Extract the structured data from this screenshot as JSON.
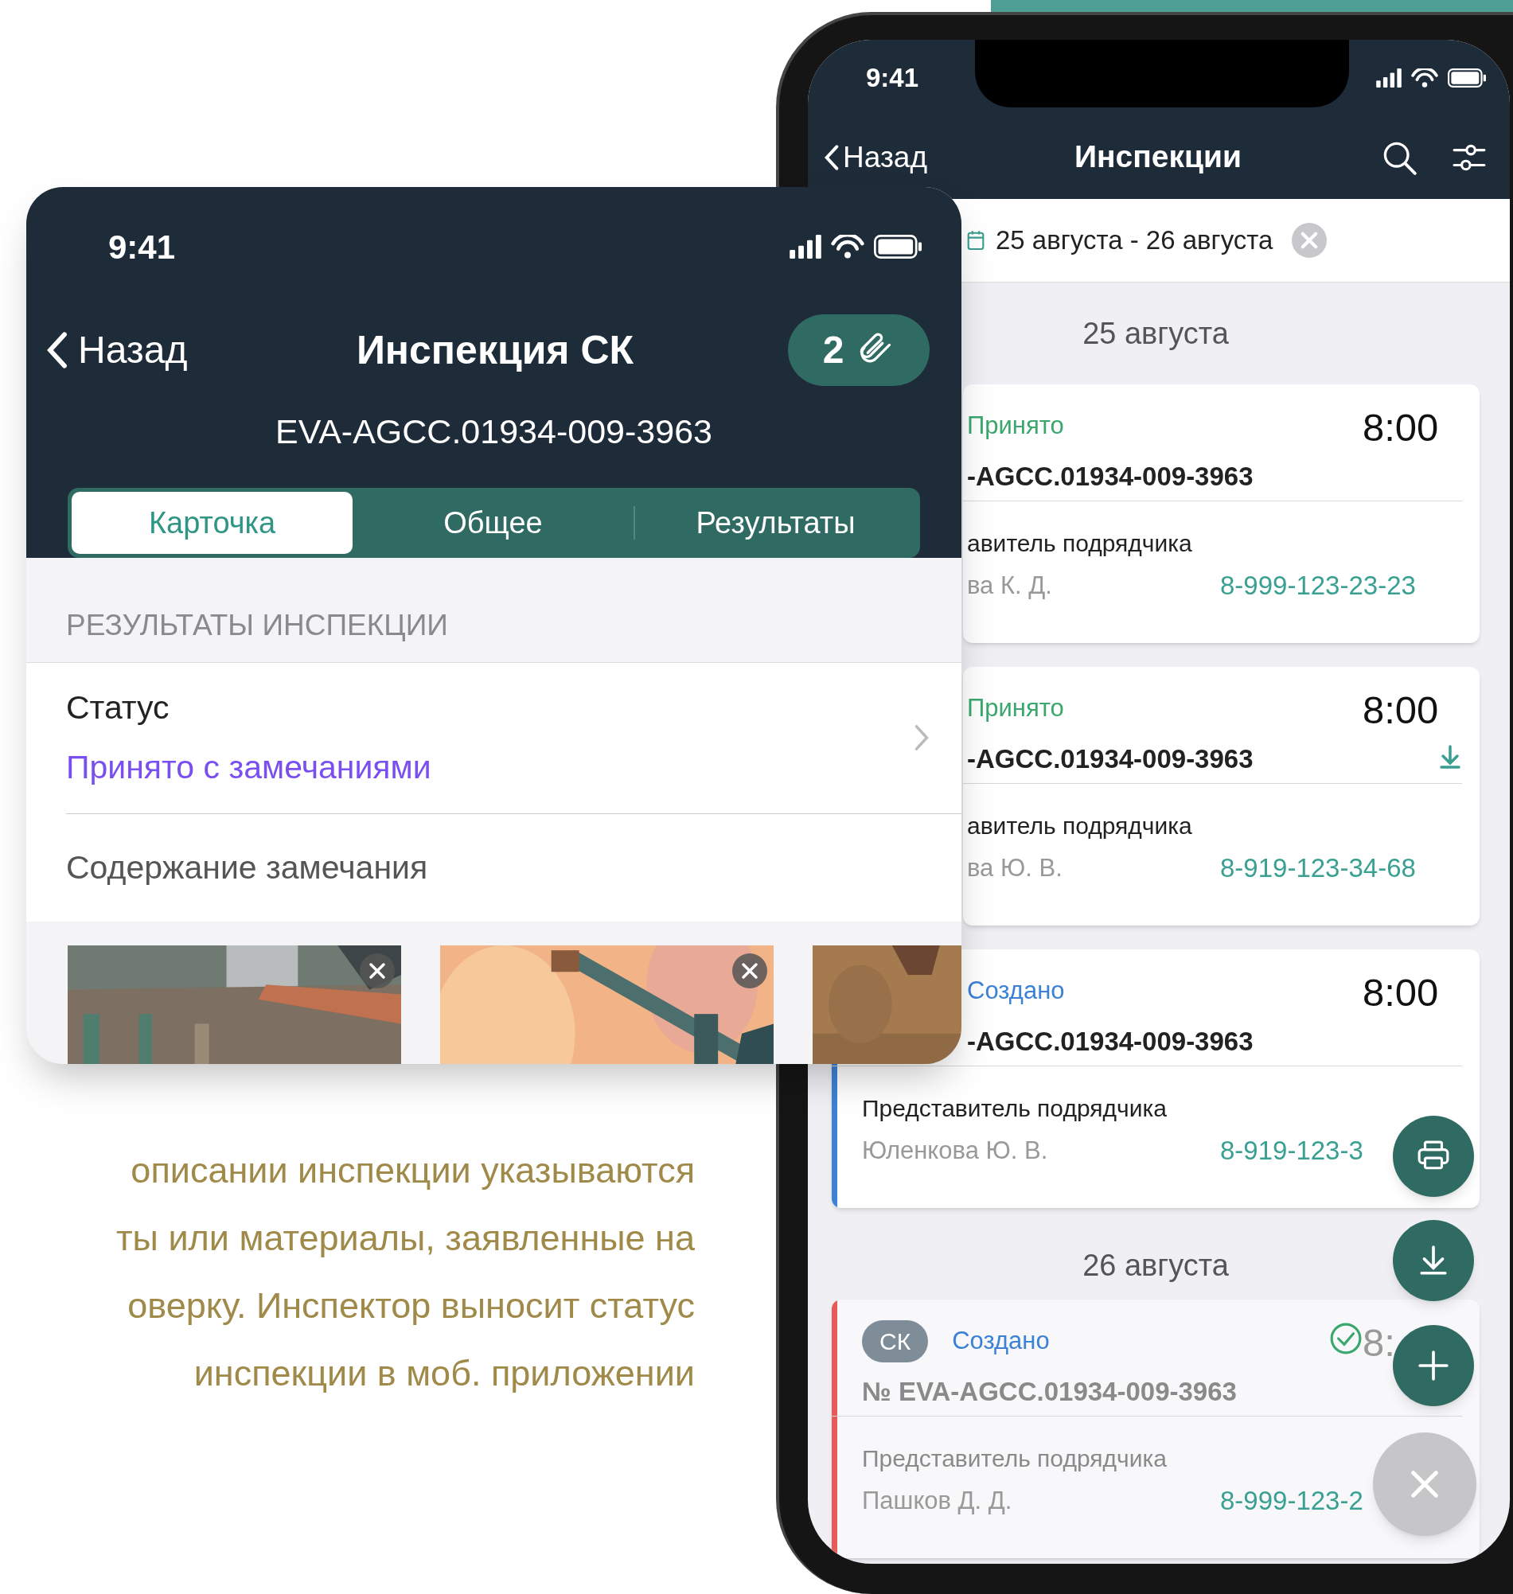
{
  "inspection_card": {
    "status_bar": {
      "time": "9:41"
    },
    "nav": {
      "back": "Назад",
      "title": "Инспекция СК",
      "attachments_count": "2"
    },
    "subtitle": "EVA-AGCC.01934-009-3963",
    "tabs": [
      {
        "label": "Карточка",
        "selected": true
      },
      {
        "label": "Общее",
        "selected": false
      },
      {
        "label": "Результаты",
        "selected": false
      }
    ],
    "section_header": "РЕЗУЛЬТАТЫ ИНСПЕКЦИИ",
    "status_row": {
      "label": "Статус",
      "value": "Принято с замечаниями"
    },
    "remark_row": {
      "label": "Содержание замечания"
    },
    "photos": [
      {
        "kind": "picture",
        "removable": true
      },
      {
        "kind": "picture",
        "removable": true
      },
      {
        "kind": "picture"
      }
    ]
  },
  "description": {
    "lines": [
      "описании инспекции указываются",
      "ты или материалы, заявленные на",
      "оверку. Инспектор выносит статус",
      "инспекции в моб. приложении"
    ]
  },
  "inspections_screen": {
    "status_bar": {
      "time": "9:41"
    },
    "nav": {
      "back": "Назад",
      "title": "Инспекции"
    },
    "date_filter": {
      "value": "25 августа - 26 августа"
    },
    "groups": [
      {
        "date": "25 августа",
        "cards": [
          {
            "kind": "accepted",
            "status": "Принято",
            "time": "8:00",
            "number": "-AGCC.01934-009-3963",
            "download": false,
            "checked": false,
            "label": "авитель подрядчика",
            "name": "ва К. Д.",
            "phone": "8-999-123-23-23",
            "faded": false
          },
          {
            "kind": "accepted",
            "status": "Принято",
            "time": "8:00",
            "number": "-AGCC.01934-009-3963",
            "download": true,
            "checked": false,
            "label": "авитель подрядчика",
            "name": "ва Ю. В.",
            "phone": "8-919-123-34-68",
            "faded": false
          },
          {
            "kind": "created",
            "color": "#3b82d6",
            "status": "Создано",
            "time": "8:00",
            "number": "-AGCC.01934-009-3963",
            "download": false,
            "checked": false,
            "label": "Представитель подрядчика",
            "name": "Юленкова Ю. В.",
            "phone": "8-919-123-3",
            "faded": false
          }
        ]
      },
      {
        "date": "26 августа",
        "cards": [
          {
            "kind": "created",
            "color": "#e85a5a",
            "badge": "СК",
            "status": "Создано",
            "time": "8:",
            "number": "№ EVA-AGCC.01934-009-3963",
            "download": false,
            "checked": true,
            "label": "Представитель подрядчика",
            "name": "Пашков Д. Д.",
            "phone": "8-999-123-2",
            "faded": true
          }
        ]
      }
    ],
    "fabs": [
      {
        "kind": "print"
      },
      {
        "kind": "download"
      },
      {
        "kind": "add"
      },
      {
        "kind": "close"
      }
    ]
  }
}
